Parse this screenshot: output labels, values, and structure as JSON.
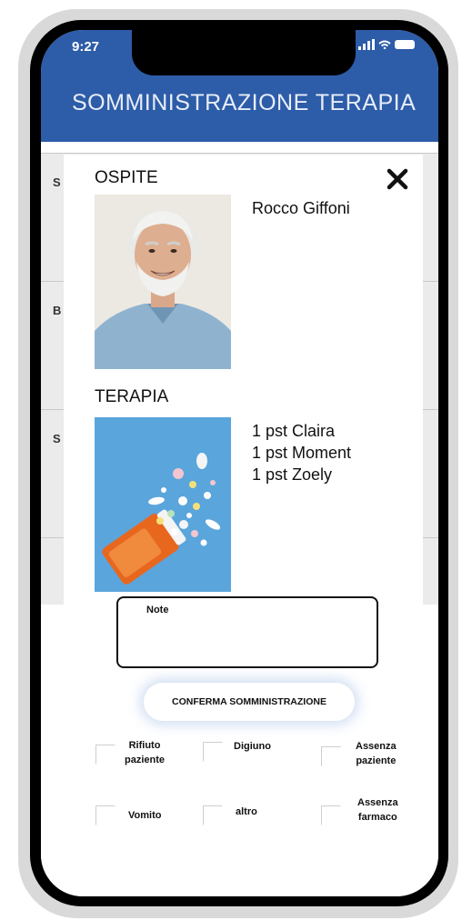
{
  "status_bar": {
    "time": "9:27"
  },
  "header": {
    "title": "SOMMINISTRAZIONE TERAPIA"
  },
  "background_rows": [
    {
      "letter": "S"
    },
    {
      "letter": "B"
    },
    {
      "letter": "S"
    }
  ],
  "modal": {
    "guest_label": "OSPITE",
    "patient_name": "Rocco Giffoni",
    "therapy_label": "TERAPIA",
    "therapy_items": [
      "1 pst Claira",
      "1 pst Moment",
      "1 pst Zoely"
    ],
    "close_icon": "close-icon"
  },
  "note": {
    "label": "Note",
    "value": ""
  },
  "confirm_button": {
    "label": "CONFERMA SOMMINISTRAZIONE"
  },
  "options": [
    {
      "line1": "Rifiuto",
      "line2": "paziente"
    },
    {
      "line1": "Digiuno",
      "line2": ""
    },
    {
      "line1": "Assenza",
      "line2": "paziente"
    },
    {
      "line1": "Vomito",
      "line2": ""
    },
    {
      "line1": "altro",
      "line2": ""
    },
    {
      "line1": "Assenza",
      "line2": "farmaco"
    }
  ],
  "colors": {
    "header": "#2d5ca8",
    "frame": "#d9d9d9"
  }
}
